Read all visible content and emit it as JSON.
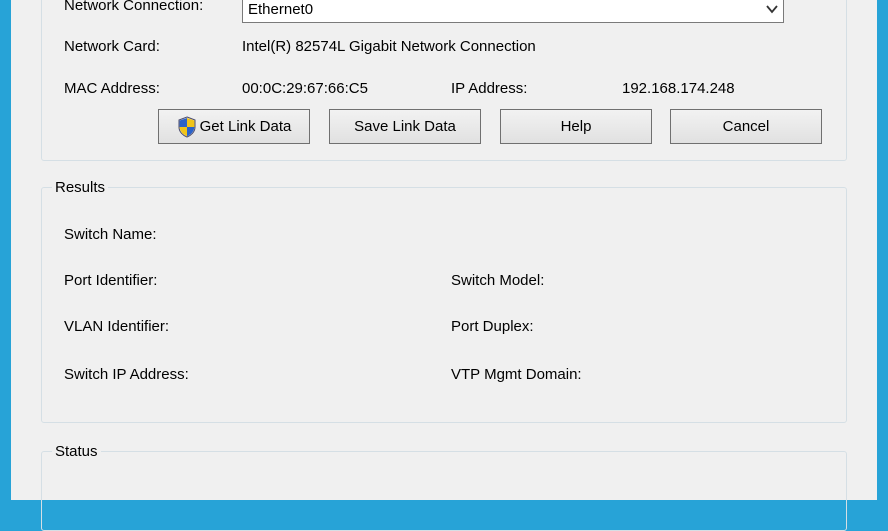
{
  "connection": {
    "label": "Network Connection:",
    "value": "Ethernet0",
    "card_label": "Network Card:",
    "card_value": "Intel(R) 82574L Gigabit Network Connection",
    "mac_label": "MAC Address:",
    "mac_value": "00:0C:29:67:66:C5",
    "ip_label": "IP Address:",
    "ip_value": "192.168.174.248"
  },
  "buttons": {
    "get_link": "Get Link Data",
    "save_link": "Save Link Data",
    "help": "Help",
    "cancel": "Cancel"
  },
  "results": {
    "title": "Results",
    "switch_name": "Switch Name:",
    "port_identifier": "Port Identifier:",
    "switch_model": "Switch Model:",
    "vlan_identifier": "VLAN Identifier:",
    "port_duplex": "Port Duplex:",
    "switch_ip": "Switch IP Address:",
    "vtp_domain": "VTP Mgmt Domain:"
  },
  "status": {
    "title": "Status"
  },
  "colors": {
    "desktop": "#27a3d7",
    "window": "#f0f0f0",
    "group_border": "#d5dfe5"
  },
  "icons": {
    "uac": "uac-shield-icon",
    "dropdown": "chevron-down-icon"
  }
}
